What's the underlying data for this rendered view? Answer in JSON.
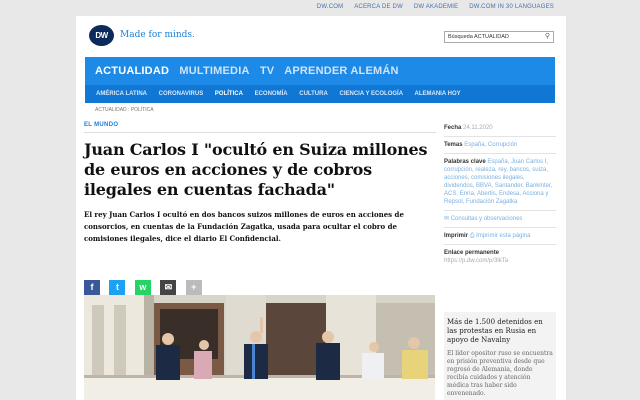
{
  "topbar": {
    "links": [
      "DW.COM",
      "ACERCA DE DW",
      "DW AKADEMIE",
      "DW.COM IN 30 LANGUAGES"
    ]
  },
  "header": {
    "logo": "DW",
    "tagline": "Made for minds.",
    "search_placeholder": "Búsqueda ACTUALIDAD"
  },
  "nav": {
    "main": [
      "ACTUALIDAD",
      "MULTIMEDIA",
      "TV",
      "APRENDER ALEMÁN"
    ],
    "sub": [
      "AMÉRICA LATINA",
      "CORONAVIRUS",
      "POLÍTICA",
      "ECONOMÍA",
      "CULTURA",
      "CIENCIA Y ECOLOGÍA",
      "ALEMANIA HOY"
    ]
  },
  "breadcrumb": "ACTUALIDAD : POLÍTICA",
  "article": {
    "kicker": "EL MUNDO",
    "headline": "Juan Carlos I \"ocultó en Suiza millones de euros en acciones y de cobros ilegales en cuentas fachada\"",
    "lead": "El rey Juan Carlos I ocultó en dos bancos suizos millones de euros en acciones de consorcios, en cuentas de la Fundación Zagatka, usada para ocultar el cobro de comisiones ilegales, dice el diario El Confidencial."
  },
  "share": {
    "facebook": "f",
    "twitter": "t",
    "whatsapp": "w",
    "email": "✉",
    "more": "+"
  },
  "sidebar": {
    "fecha_label": "Fecha",
    "fecha": "24.11.2020",
    "temas_label": "Temas",
    "temas": "España, Corrupción",
    "palabras_label": "Palabras clave",
    "palabras": "España, Juan Carlos I, corrupción, realeza, rey, bancos, suiza, acciones, comisiones ilegales, dividendos, BBVA, Santander, Bankinter, ACS, Enría, Abertis, Endesa, Acciona y Repsol, Fundación Zagatka",
    "consultas": "Consultas y observaciones",
    "imprimir_label": "Imprimir",
    "imprimir": "Imprimir esta página",
    "enlace_label": "Enlace permanente",
    "enlace": "https://p.dw.com/p/3lkTa",
    "box_title": "Más de 1.500 detenidos en las protestas en Rusia en apoyo de Navalny",
    "box_text": "El líder opositor ruso se encuentra en prisión preventiva desde que regresó de Alemania, donde recibía cuidados y atención médica tras haber sido envenenado."
  },
  "colors": {
    "brand_blue": "#1c8ae6",
    "nav_dark": "#1177d4",
    "logo_navy": "#0c2a5c"
  }
}
